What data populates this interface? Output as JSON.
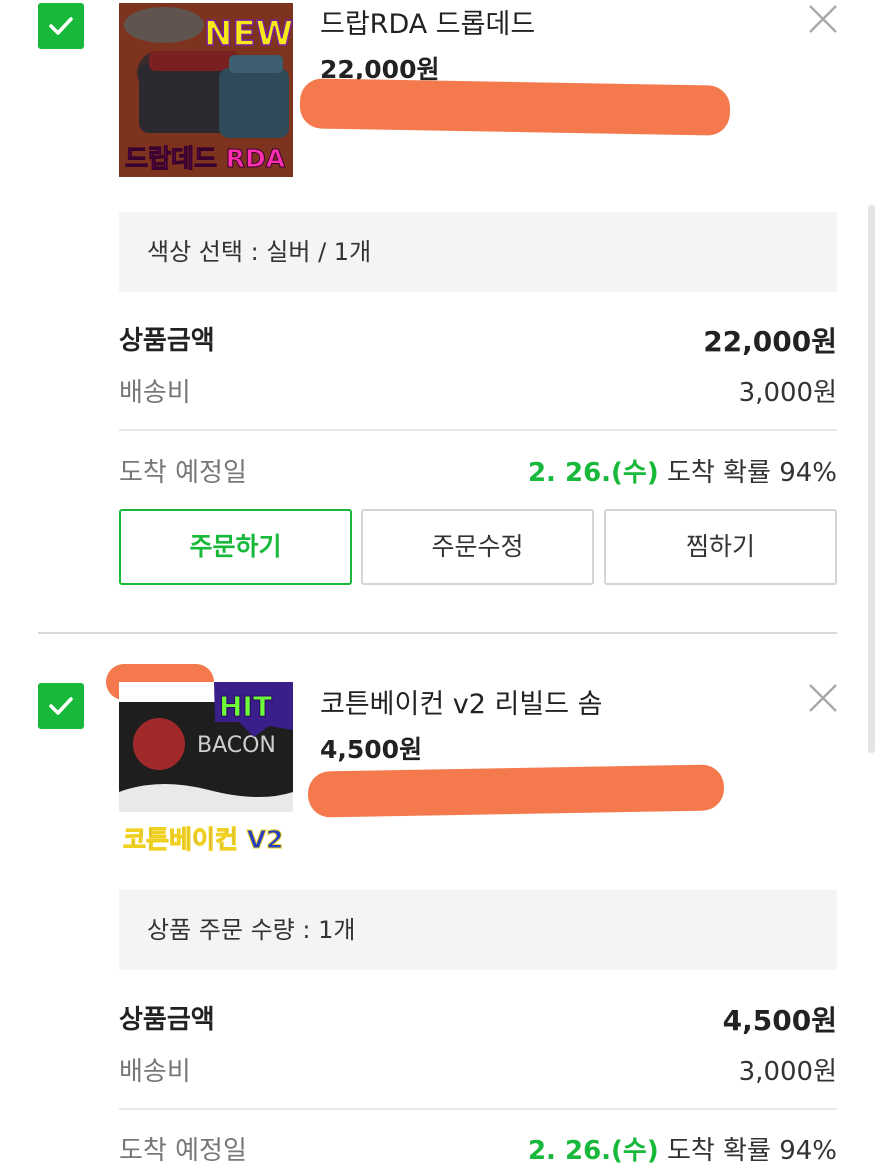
{
  "items": [
    {
      "name": "드랍RDA 드롭데드",
      "price": "22,000원",
      "thumb_text": "드랍데드 RDA",
      "thumb_badge": "NEW",
      "option": "색상 선택 : 실버 / 1개",
      "amount_label": "상품금액",
      "amount_value": "22,000원",
      "shipping_label": "배송비",
      "shipping_value": "3,000원",
      "arrival_label": "도착 예정일",
      "arrival_date": "2. 26.(수)",
      "arrival_rest": " 도착 확률 94%",
      "buttons": {
        "order": "주문하기",
        "modify": "주문수정",
        "wish": "찜하기"
      }
    },
    {
      "name": "코튼베이컨 v2 리빌드 솜",
      "price": "4,500원",
      "thumb_text": "코튼베이컨 V2",
      "thumb_badge": "HIT",
      "option": "상품 주문 수량 : 1개",
      "amount_label": "상품금액",
      "amount_value": "4,500원",
      "shipping_label": "배송비",
      "shipping_value": "3,000원",
      "arrival_label": "도착 예정일",
      "arrival_date": "2. 26.(수)",
      "arrival_rest": " 도착 확률 94%"
    }
  ],
  "colors": {
    "accent_green": "#18b83b",
    "redaction": "#f47a4d"
  },
  "icons": {
    "checkbox": "checkmark-icon",
    "remove": "close-icon"
  }
}
